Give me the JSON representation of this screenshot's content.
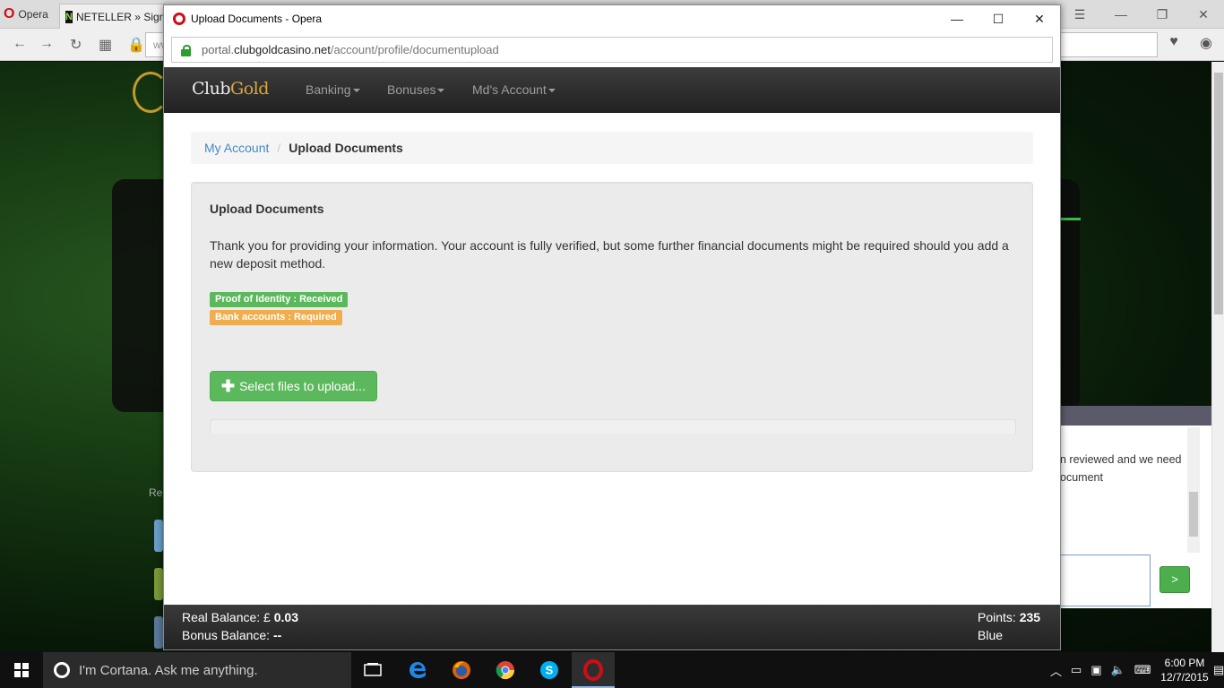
{
  "background_browser": {
    "opera_tab_label": "Opera",
    "tab_label": "NETELLER » Signi",
    "address_text": "ww",
    "chat_text_line1": "n reviewed and we need",
    "chat_text_line2": "ocument",
    "chat_send_label": ">",
    "partial_label": "Re"
  },
  "popup": {
    "window_title": "Upload Documents - Opera",
    "url_host": "portal.",
    "url_domain": "clubgoldcasino.net",
    "url_path": "/account/profile/documentupload"
  },
  "site": {
    "brand_part1": "Club",
    "brand_part2": "Gold",
    "nav": [
      "Banking",
      "Bonuses",
      "Md's Account"
    ],
    "breadcrumb": {
      "link": "My Account",
      "separator": "/",
      "active": "Upload Documents"
    },
    "panel": {
      "title": "Upload Documents",
      "message": "Thank you for providing your information. Your account is fully verified, but some further financial documents might be required should you add a new deposit method.",
      "status_identity": "Proof of Identity : Received",
      "status_bank": "Bank accounts : Required",
      "upload_button": "Select files to upload..."
    },
    "balance": {
      "real_label": "Real Balance: £",
      "real_value": "0.03",
      "bonus_label": "Bonus Balance:",
      "bonus_value": "--",
      "points_label": "Points:",
      "points_value": "235",
      "tier": "Blue"
    }
  },
  "taskbar": {
    "cortana_placeholder": "I'm Cortana. Ask me anything.",
    "time": "6:00 PM",
    "date": "12/7/2015"
  },
  "colors": {
    "success": "#5cb85c",
    "warning": "#f0ad4e",
    "link": "#428bca",
    "opera_red": "#cc0f16",
    "brand_gold": "#d9a93a"
  }
}
